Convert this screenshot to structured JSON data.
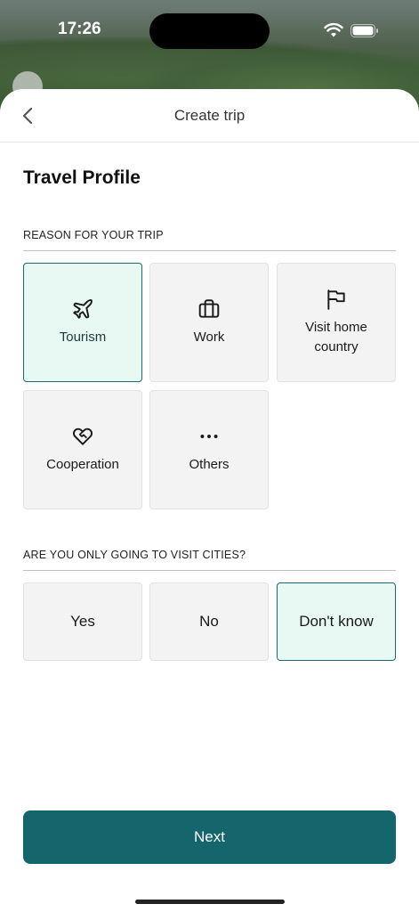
{
  "status": {
    "time": "17:26"
  },
  "header": {
    "title": "Create trip"
  },
  "page": {
    "title": "Travel Profile"
  },
  "reason": {
    "label": "REASON FOR YOUR TRIP",
    "options": [
      {
        "label": "Tourism",
        "icon": "plane-icon",
        "selected": true
      },
      {
        "label": "Work",
        "icon": "briefcase-icon",
        "selected": false
      },
      {
        "label": "Visit home country",
        "icon": "flag-icon",
        "selected": false
      },
      {
        "label": "Cooperation",
        "icon": "hand-heart-icon",
        "selected": false
      },
      {
        "label": "Others",
        "icon": "more-dots-icon",
        "selected": false
      }
    ]
  },
  "cities": {
    "label": "ARE YOU ONLY GOING TO VISIT CITIES?",
    "options": [
      {
        "label": "Yes",
        "selected": false
      },
      {
        "label": "No",
        "selected": false
      },
      {
        "label": "Don't know",
        "selected": true
      }
    ]
  },
  "footer": {
    "next_label": "Next"
  },
  "colors": {
    "accent": "#15666c",
    "selected_bg": "#e8f8f2",
    "tile_bg": "#f3f3f3"
  }
}
